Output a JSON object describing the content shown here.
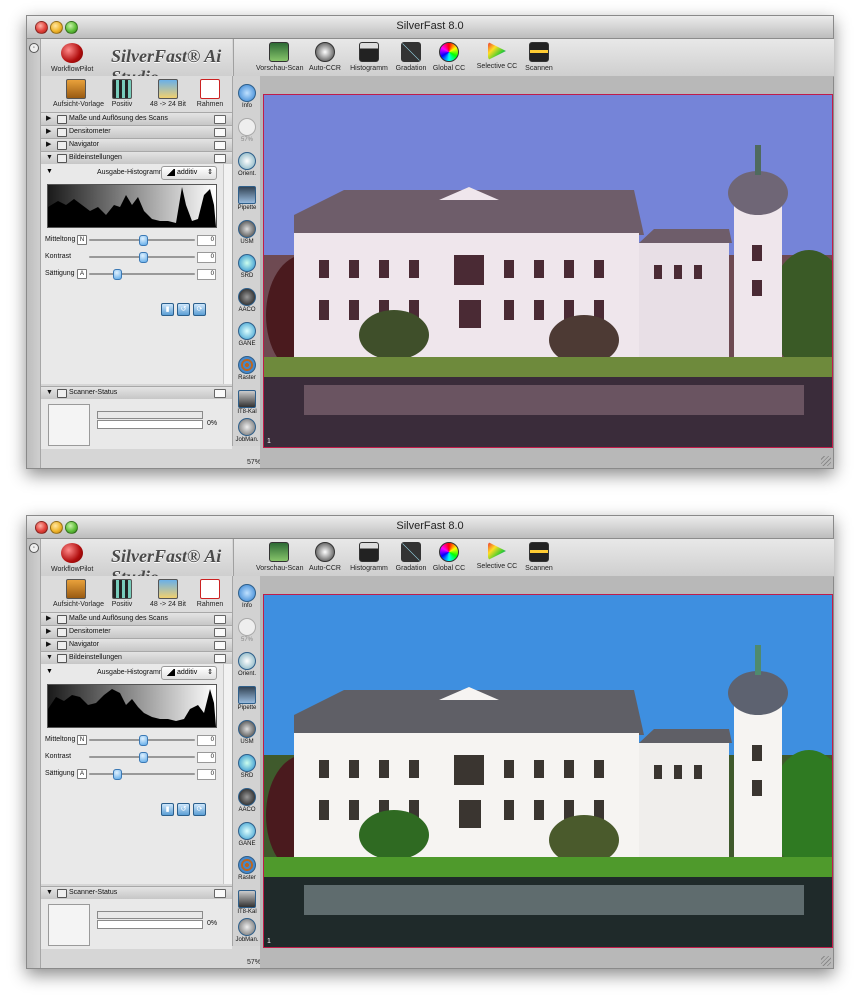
{
  "windows": [
    {
      "title": "SilverFast 8.0",
      "workflow_pilot_label": "WorkflowPilot",
      "brand": "SilverFast® Ai Studio",
      "toolbar": [
        "Vorschau-Scan",
        "Auto-CCR",
        "Histogramm",
        "Gradation",
        "Global CC",
        "Selective CC",
        "Scannen"
      ],
      "mode_buttons": [
        "Aufsicht-Vorlage",
        "Positiv",
        "48 -> 24 Bit",
        "Rahmen"
      ],
      "panels": {
        "scan_size": "Maße und Auflösung des Scans",
        "densitometer": "Densitometer",
        "navigator": "Navigator",
        "image_settings": "Bildeinstellungen",
        "scanner_status": "Scanner-Status"
      },
      "output_histogram_label": "Ausgabe-Histogramm",
      "additiv_label": "additiv",
      "sliders": [
        {
          "label": "Mitteltong",
          "mode": "N",
          "value": "0",
          "pos": 0.5
        },
        {
          "label": "Kontrast",
          "mode": "",
          "value": "0",
          "pos": 0.5
        },
        {
          "label": "Sättigung",
          "mode": "A",
          "value": "0",
          "pos": 0.25
        }
      ],
      "status_percent": "0%",
      "vertical_tools": [
        "Info",
        "57%",
        "Orient.",
        "Pipette",
        "USM",
        "SRD",
        "AACO",
        "GANE",
        "Raster",
        "IT8-Kal",
        "JobMan."
      ],
      "zoom": "57%",
      "frame_number": "1",
      "sky_color": "#7584d8",
      "tint": "magenta-cast"
    },
    {
      "title": "SilverFast 8.0",
      "workflow_pilot_label": "WorkflowPilot",
      "brand": "SilverFast® Ai Studio",
      "toolbar": [
        "Vorschau-Scan",
        "Auto-CCR",
        "Histogramm",
        "Gradation",
        "Global CC",
        "Selective CC",
        "Scannen"
      ],
      "mode_buttons": [
        "Aufsicht-Vorlage",
        "Positiv",
        "48 -> 24 Bit",
        "Rahmen"
      ],
      "panels": {
        "scan_size": "Maße und Auflösung des Scans",
        "densitometer": "Densitometer",
        "navigator": "Navigator",
        "image_settings": "Bildeinstellungen",
        "scanner_status": "Scanner-Status"
      },
      "output_histogram_label": "Ausgabe-Histogramm",
      "additiv_label": "additiv",
      "sliders": [
        {
          "label": "Mitteltong",
          "mode": "N",
          "value": "0",
          "pos": 0.5
        },
        {
          "label": "Kontrast",
          "mode": "",
          "value": "0",
          "pos": 0.5
        },
        {
          "label": "Sättigung",
          "mode": "A",
          "value": "0",
          "pos": 0.25
        }
      ],
      "status_percent": "0%",
      "vertical_tools": [
        "Info",
        "57%",
        "Orient.",
        "Pipette",
        "USM",
        "SRD",
        "AACO",
        "GANE",
        "Raster",
        "IT8-Kal",
        "JobMan."
      ],
      "zoom": "57%",
      "frame_number": "1",
      "sky_color": "#3e8fe0",
      "tint": "corrected"
    }
  ]
}
